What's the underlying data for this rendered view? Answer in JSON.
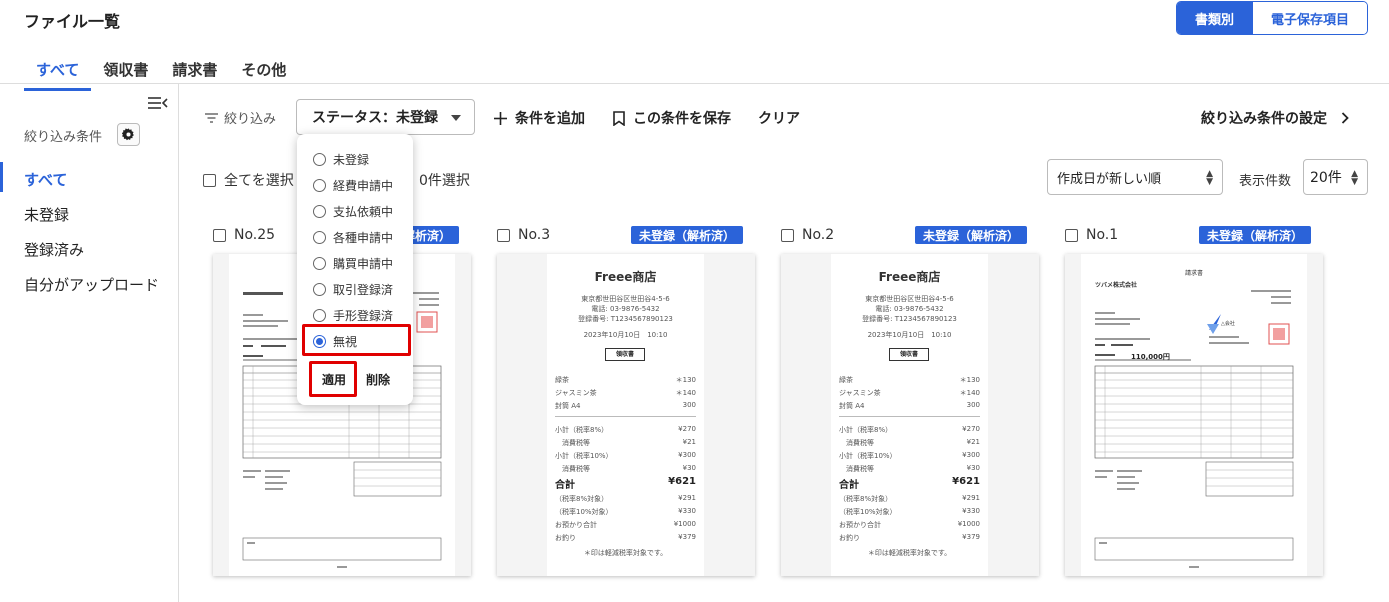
{
  "header": {
    "title": "ファイル一覧",
    "view_toggle": {
      "active": "書類別",
      "inactive": "電子保存項目"
    }
  },
  "tabs": [
    "すべて",
    "領収書",
    "請求書",
    "その他"
  ],
  "sidebar": {
    "filter_conditions_label": "絞り込み条件",
    "items": [
      "すべて",
      "未登録",
      "登録済み",
      "自分がアップロード"
    ]
  },
  "filterbar": {
    "filter_label": "絞り込み",
    "status_select": "ステータス：未登録",
    "add_condition": "条件を追加",
    "save_condition": "この条件を保存",
    "clear": "クリア",
    "filter_settings": "絞り込み条件の設定"
  },
  "selection": {
    "select_all": "全てを選択",
    "selected_count": "0件選択",
    "sort_value": "作成日が新しい順",
    "per_page_label": "表示件数",
    "per_page_value": "20件"
  },
  "dropdown": {
    "options": [
      "未登録",
      "経費申請中",
      "支払依頼中",
      "各種申請中",
      "購買申請中",
      "取引登録済",
      "手形登録済",
      "無視"
    ],
    "selected": "無視",
    "apply": "適用",
    "delete": "削除"
  },
  "cards": [
    {
      "no": "No.25",
      "badge": "未登録（解析済）"
    },
    {
      "no": "No.3",
      "badge": "未登録（解析済）"
    },
    {
      "no": "No.2",
      "badge": "未登録（解析済）"
    },
    {
      "no": "No.1",
      "badge": "未登録（解析済）"
    }
  ],
  "receipt": {
    "shop": "Freee商店",
    "address": "東京都世田谷区世田谷4-5-6",
    "phone": "電話: 03-9876-5432",
    "reg": "登録番号: T1234567890123",
    "datetime": "2023年10月10日　10:10",
    "doc_label": "領収書",
    "items": [
      {
        "name": "緑茶",
        "amount": "＊130"
      },
      {
        "name": "ジャスミン茶",
        "amount": "＊140"
      },
      {
        "name": "封筒 A4",
        "amount": "300"
      }
    ],
    "subtotals": [
      {
        "name": "小計（税率8%）",
        "amount": "¥270"
      },
      {
        "name": "　消費税等",
        "amount": "¥21"
      },
      {
        "name": "小計（税率10%）",
        "amount": "¥300"
      },
      {
        "name": "　消費税等",
        "amount": "¥30"
      }
    ],
    "total_label": "合計",
    "total": "¥621",
    "after": [
      {
        "name": "（税率8%対象）",
        "amount": "¥291"
      },
      {
        "name": "（税率10%対象）",
        "amount": "¥330"
      },
      {
        "name": "お預かり合計",
        "amount": "¥1000"
      },
      {
        "name": "お釣り",
        "amount": "¥379"
      }
    ],
    "note": "＊印は軽減税率対象です。"
  },
  "invoice": {
    "title": "請求書",
    "customer": "ツバメ株式会社",
    "amount": "110,000円",
    "company_mark": "△会社"
  }
}
